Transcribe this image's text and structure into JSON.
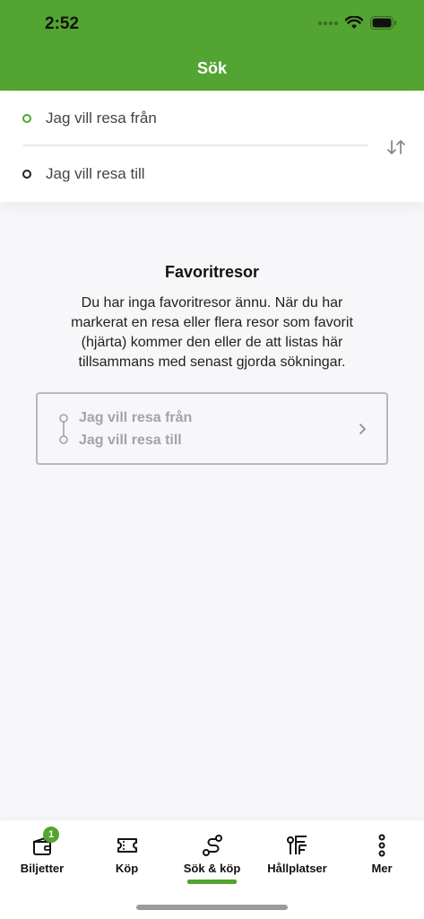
{
  "status_bar": {
    "time": "2:52"
  },
  "header": {
    "title": "Sök",
    "background_color": "#53a431"
  },
  "search": {
    "from_placeholder": "Jag vill resa från",
    "to_placeholder": "Jag vill resa till",
    "swap_icon": "swap-vertical-icon"
  },
  "favorites": {
    "title": "Favoritresor",
    "description": "Du har inga favoritresor ännu. När du har markerat en resa eller flera resor som favorit (hjärta) kommer den eller de att listas här tillsammans med senast gjorda sökningar.",
    "example_from": "Jag vill resa från",
    "example_to": "Jag vill resa till"
  },
  "tabs": [
    {
      "label": "Biljetter",
      "icon": "wallet-icon",
      "badge": "1"
    },
    {
      "label": "Köp",
      "icon": "ticket-icon"
    },
    {
      "label": "Sök & köp",
      "icon": "route-icon",
      "active": true
    },
    {
      "label": "Hållplatser",
      "icon": "stop-sign-icon"
    },
    {
      "label": "Mer",
      "icon": "more-vertical-icon"
    }
  ],
  "accent_color": "#53a431"
}
